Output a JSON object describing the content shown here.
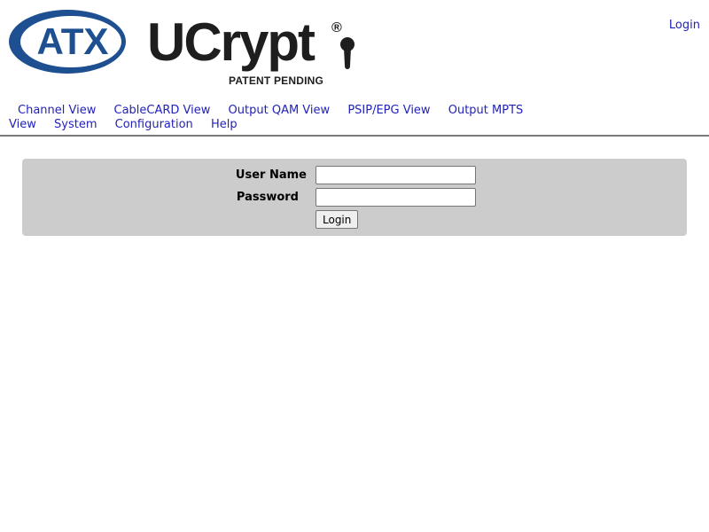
{
  "header": {
    "atx_logo_text": "ATX",
    "ucrypt_logo_text": "UCrypt",
    "registered_mark": "®",
    "patent_text": "PATENT PENDING",
    "login_link": "Login"
  },
  "nav": {
    "items": [
      {
        "label": "Channel View"
      },
      {
        "label": "CableCARD View"
      },
      {
        "label": "Output QAM View"
      },
      {
        "label": "PSIP/EPG View"
      },
      {
        "label": "Output MPTS View"
      },
      {
        "label": "System"
      },
      {
        "label": "Configuration"
      },
      {
        "label": "Help"
      }
    ]
  },
  "login_form": {
    "username_label": "User Name",
    "username_value": "",
    "password_label": "Password",
    "password_value": "",
    "submit_label": "Login"
  },
  "colors": {
    "link": "#2222bb",
    "logo_blue": "#1d4f91",
    "panel_bg": "#cccccc"
  }
}
